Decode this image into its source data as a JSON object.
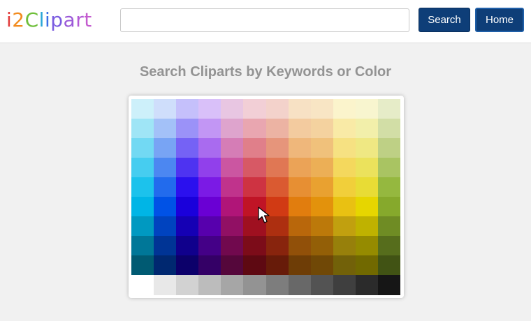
{
  "header": {
    "logo": {
      "letters": [
        {
          "char": "i",
          "color": "#e23b3b"
        },
        {
          "char": "2",
          "color": "#f28b1e"
        },
        {
          "char": "C",
          "color": "#6fbf3a"
        },
        {
          "char": "l",
          "color": "#2aa7d8"
        },
        {
          "char": "i",
          "color": "#3b6ee6"
        },
        {
          "char": "p",
          "color": "#7a5be0"
        },
        {
          "char": "a",
          "color": "#9b59d8"
        },
        {
          "char": "r",
          "color": "#b35ad6"
        },
        {
          "char": "t",
          "color": "#c45ccf"
        }
      ]
    },
    "search": {
      "value": "",
      "placeholder": ""
    },
    "search_label": "Search",
    "home_label": "Home"
  },
  "main": {
    "title": "Search Cliparts by Keywords or Color"
  },
  "palette": {
    "columns": 12,
    "rows": [
      [
        "#cdf0fa",
        "#cfdefb",
        "#c5c0fb",
        "#d9c0f9",
        "#e8c6e2",
        "#f2cfd6",
        "#f3d2cb",
        "#f7e1c4",
        "#f8e5c4",
        "#fbf4cc",
        "#f8f5cf",
        "#e6ecc8"
      ],
      [
        "#9fe5f6",
        "#a3c1f8",
        "#9b92f8",
        "#c296f4",
        "#dea4cd",
        "#e9a6b0",
        "#ecb3a3",
        "#f3cb9f",
        "#f4d29f",
        "#f9eaa6",
        "#f2efaa",
        "#d2dea6"
      ],
      [
        "#72d9f3",
        "#78a4f4",
        "#7562f5",
        "#a96bef",
        "#d57db6",
        "#e07f8a",
        "#e6957b",
        "#efb77b",
        "#f0c17b",
        "#f6e182",
        "#efe883",
        "#bed085"
      ],
      [
        "#46cdf0",
        "#4c87f1",
        "#4e33f1",
        "#9140eb",
        "#cb56a1",
        "#d75965",
        "#e07754",
        "#eba357",
        "#ecaf56",
        "#f4d85d",
        "#ebe25c",
        "#a9c462"
      ],
      [
        "#1cc2ec",
        "#226bed",
        "#2b10ee",
        "#7b1ae5",
        "#c0338c",
        "#ce3342",
        "#da5a31",
        "#e78f33",
        "#e9a130",
        "#f1cf3a",
        "#e8dc35",
        "#95b83f"
      ],
      [
        "#00b5e6",
        "#0052e6",
        "#1a00db",
        "#6a00d4",
        "#b01578",
        "#c01426",
        "#d13a14",
        "#e17d0e",
        "#e3920c",
        "#e9c112",
        "#e6d600",
        "#86a92c"
      ],
      [
        "#0099c1",
        "#0043bf",
        "#1500b4",
        "#5700ad",
        "#911064",
        "#9f1020",
        "#ad2f10",
        "#b9670b",
        "#bc790a",
        "#c1a00f",
        "#bfb200",
        "#6f8c24"
      ],
      [
        "#007798",
        "#003495",
        "#10008c",
        "#440087",
        "#71094e",
        "#7c0c19",
        "#88240d",
        "#915009",
        "#935f07",
        "#97800b",
        "#958b00",
        "#566d1c"
      ],
      [
        "#005a72",
        "#002870",
        "#0c006a",
        "#340066",
        "#55073b",
        "#5e0912",
        "#671b09",
        "#6e3d06",
        "#704806",
        "#726109",
        "#716900",
        "#415314"
      ],
      [
        "#ffffff",
        "#e8e8e8",
        "#d2d2d2",
        "#bcbcbc",
        "#a6a6a6",
        "#939393",
        "#7d7d7d",
        "#686868",
        "#535353",
        "#3f3f3f",
        "#2b2b2b",
        "#161616"
      ]
    ]
  }
}
